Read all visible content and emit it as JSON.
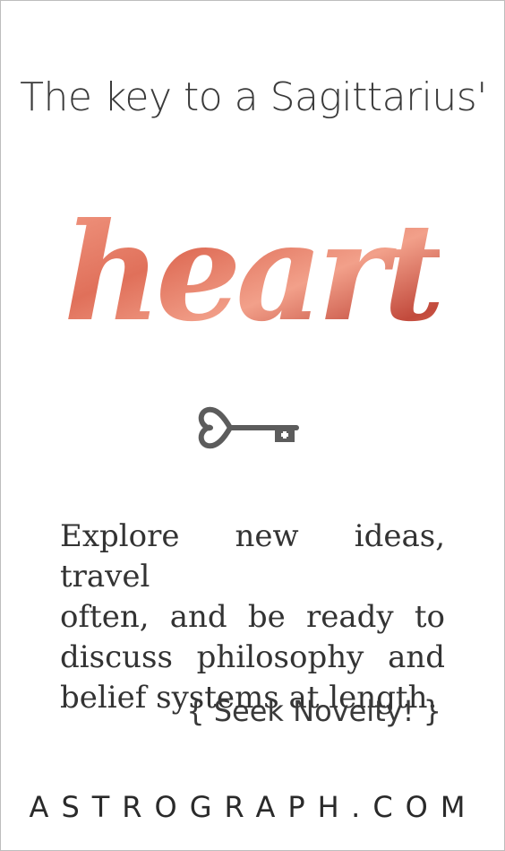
{
  "headline": "The key to a Sagittarius'",
  "feature_word": "heart",
  "body_lines": [
    "Explore new ideas, travel",
    "often, and be ready to",
    "discuss philosophy and",
    "belief systems at length."
  ],
  "tagline": "{ Seek Novelty! }",
  "site": "ASTROGRAPH.COM",
  "colors": {
    "text": "#333333",
    "accent_coral": "#e0705a",
    "accent_deep": "#c24a3c",
    "key_gray": "#5c5c5c"
  },
  "icons": [
    "key-icon"
  ]
}
